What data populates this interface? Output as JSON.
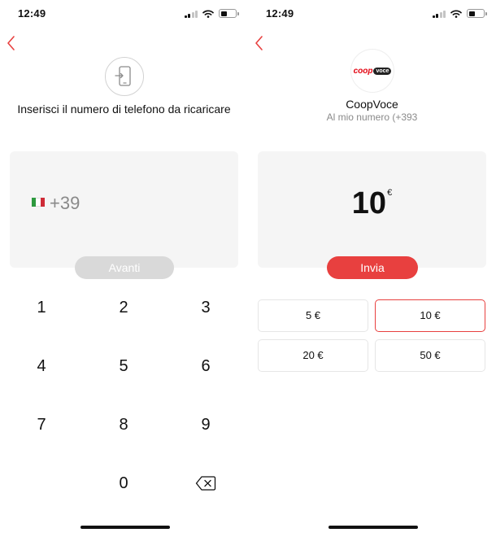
{
  "left": {
    "status": {
      "time": "12:49"
    },
    "prompt": "Inserisci il numero di telefono da ricaricare",
    "country": {
      "flag_colors": [
        "#2e9a3f",
        "#ffffff",
        "#ce2b37"
      ],
      "prefix": "+39"
    },
    "continue_label": "Avanti",
    "keypad": [
      "1",
      "2",
      "3",
      "4",
      "5",
      "6",
      "7",
      "8",
      "9",
      "0"
    ]
  },
  "right": {
    "status": {
      "time": "12:49"
    },
    "operator": {
      "logo_prefix": "coop",
      "logo_badge": "voce",
      "name": "CoopVoce",
      "number_line": "Al mio numero (+393"
    },
    "amount": {
      "value": "10",
      "currency": "€"
    },
    "send_label": "Invia",
    "options": [
      "5 €",
      "10 €",
      "20 €",
      "50 €"
    ],
    "selected_option": "10 €"
  },
  "colors": {
    "accent": "#e8403f",
    "disabled_button": "#d9d9d9",
    "panel": "#f5f5f5"
  },
  "icons": [
    "back-chevron-icon",
    "phone-transfer-icon",
    "backspace-icon",
    "wifi-icon",
    "battery-icon",
    "signal-icon"
  ]
}
